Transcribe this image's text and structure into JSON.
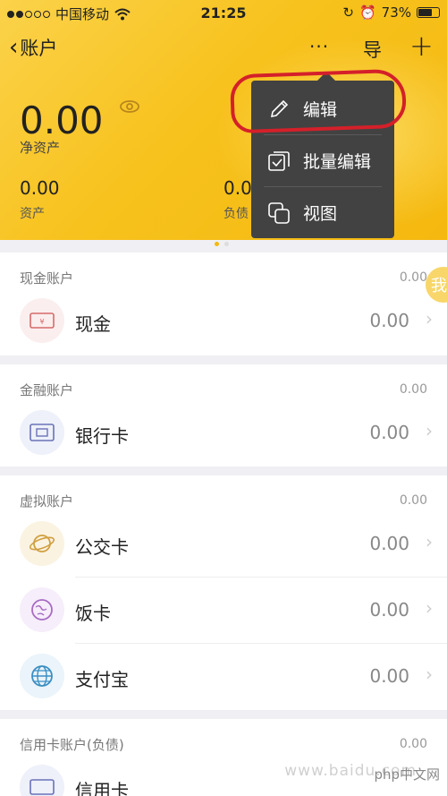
{
  "status_bar": {
    "carrier": "中国移动",
    "time": "21:25",
    "battery": "73%",
    "battery_fraction": 0.73
  },
  "nav": {
    "back_label": "账户",
    "more_label": "···",
    "import_label": "导",
    "add_label": "+"
  },
  "summary": {
    "net_assets_value": "0.00",
    "net_assets_label": "净资产",
    "assets_value": "0.00",
    "assets_label": "资产",
    "debt_value": "0.0",
    "debt_label": "负债"
  },
  "popup_menu": {
    "items": [
      {
        "label": "编辑",
        "icon": "pencil-icon"
      },
      {
        "label": "批量编辑",
        "icon": "batch-edit-icon"
      },
      {
        "label": "视图",
        "icon": "view-icon"
      }
    ]
  },
  "sections": [
    {
      "title": "现金账户",
      "total": "0.00",
      "rows": [
        {
          "name": "现金",
          "amount": "0.00",
          "icon": "cash-icon"
        }
      ]
    },
    {
      "title": "金融账户",
      "total": "0.00",
      "rows": [
        {
          "name": "银行卡",
          "amount": "0.00",
          "icon": "bank-card-icon"
        }
      ]
    },
    {
      "title": "虚拟账户",
      "total": "0.00",
      "rows": [
        {
          "name": "公交卡",
          "amount": "0.00",
          "icon": "bus-card-icon"
        },
        {
          "name": "饭卡",
          "amount": "0.00",
          "icon": "meal-card-icon"
        },
        {
          "name": "支付宝",
          "amount": "0.00",
          "icon": "alipay-icon"
        }
      ]
    },
    {
      "title": "信用卡账户(负债)",
      "total": "0.00",
      "rows": [
        {
          "name": "信用卡",
          "amount": "",
          "icon": "credit-card-icon"
        }
      ]
    }
  ],
  "side_button_label": "我",
  "watermark": "www.baidu.com",
  "watermark_logo": "php中文网",
  "colors": {
    "header": "#f7c21d",
    "popup_bg": "#424242",
    "highlight": "#d4202a"
  }
}
